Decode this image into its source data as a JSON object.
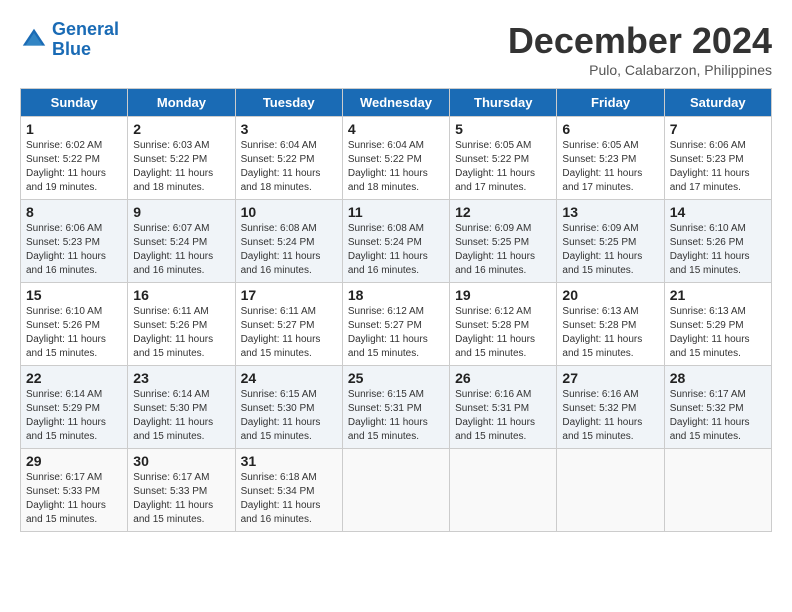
{
  "header": {
    "logo_line1": "General",
    "logo_line2": "Blue",
    "month": "December 2024",
    "location": "Pulo, Calabarzon, Philippines"
  },
  "days_of_week": [
    "Sunday",
    "Monday",
    "Tuesday",
    "Wednesday",
    "Thursday",
    "Friday",
    "Saturday"
  ],
  "weeks": [
    [
      {
        "day": "1",
        "info": "Sunrise: 6:02 AM\nSunset: 5:22 PM\nDaylight: 11 hours\nand 19 minutes."
      },
      {
        "day": "2",
        "info": "Sunrise: 6:03 AM\nSunset: 5:22 PM\nDaylight: 11 hours\nand 18 minutes."
      },
      {
        "day": "3",
        "info": "Sunrise: 6:04 AM\nSunset: 5:22 PM\nDaylight: 11 hours\nand 18 minutes."
      },
      {
        "day": "4",
        "info": "Sunrise: 6:04 AM\nSunset: 5:22 PM\nDaylight: 11 hours\nand 18 minutes."
      },
      {
        "day": "5",
        "info": "Sunrise: 6:05 AM\nSunset: 5:22 PM\nDaylight: 11 hours\nand 17 minutes."
      },
      {
        "day": "6",
        "info": "Sunrise: 6:05 AM\nSunset: 5:23 PM\nDaylight: 11 hours\nand 17 minutes."
      },
      {
        "day": "7",
        "info": "Sunrise: 6:06 AM\nSunset: 5:23 PM\nDaylight: 11 hours\nand 17 minutes."
      }
    ],
    [
      {
        "day": "8",
        "info": "Sunrise: 6:06 AM\nSunset: 5:23 PM\nDaylight: 11 hours\nand 16 minutes."
      },
      {
        "day": "9",
        "info": "Sunrise: 6:07 AM\nSunset: 5:24 PM\nDaylight: 11 hours\nand 16 minutes."
      },
      {
        "day": "10",
        "info": "Sunrise: 6:08 AM\nSunset: 5:24 PM\nDaylight: 11 hours\nand 16 minutes."
      },
      {
        "day": "11",
        "info": "Sunrise: 6:08 AM\nSunset: 5:24 PM\nDaylight: 11 hours\nand 16 minutes."
      },
      {
        "day": "12",
        "info": "Sunrise: 6:09 AM\nSunset: 5:25 PM\nDaylight: 11 hours\nand 16 minutes."
      },
      {
        "day": "13",
        "info": "Sunrise: 6:09 AM\nSunset: 5:25 PM\nDaylight: 11 hours\nand 15 minutes."
      },
      {
        "day": "14",
        "info": "Sunrise: 6:10 AM\nSunset: 5:26 PM\nDaylight: 11 hours\nand 15 minutes."
      }
    ],
    [
      {
        "day": "15",
        "info": "Sunrise: 6:10 AM\nSunset: 5:26 PM\nDaylight: 11 hours\nand 15 minutes."
      },
      {
        "day": "16",
        "info": "Sunrise: 6:11 AM\nSunset: 5:26 PM\nDaylight: 11 hours\nand 15 minutes."
      },
      {
        "day": "17",
        "info": "Sunrise: 6:11 AM\nSunset: 5:27 PM\nDaylight: 11 hours\nand 15 minutes."
      },
      {
        "day": "18",
        "info": "Sunrise: 6:12 AM\nSunset: 5:27 PM\nDaylight: 11 hours\nand 15 minutes."
      },
      {
        "day": "19",
        "info": "Sunrise: 6:12 AM\nSunset: 5:28 PM\nDaylight: 11 hours\nand 15 minutes."
      },
      {
        "day": "20",
        "info": "Sunrise: 6:13 AM\nSunset: 5:28 PM\nDaylight: 11 hours\nand 15 minutes."
      },
      {
        "day": "21",
        "info": "Sunrise: 6:13 AM\nSunset: 5:29 PM\nDaylight: 11 hours\nand 15 minutes."
      }
    ],
    [
      {
        "day": "22",
        "info": "Sunrise: 6:14 AM\nSunset: 5:29 PM\nDaylight: 11 hours\nand 15 minutes."
      },
      {
        "day": "23",
        "info": "Sunrise: 6:14 AM\nSunset: 5:30 PM\nDaylight: 11 hours\nand 15 minutes."
      },
      {
        "day": "24",
        "info": "Sunrise: 6:15 AM\nSunset: 5:30 PM\nDaylight: 11 hours\nand 15 minutes."
      },
      {
        "day": "25",
        "info": "Sunrise: 6:15 AM\nSunset: 5:31 PM\nDaylight: 11 hours\nand 15 minutes."
      },
      {
        "day": "26",
        "info": "Sunrise: 6:16 AM\nSunset: 5:31 PM\nDaylight: 11 hours\nand 15 minutes."
      },
      {
        "day": "27",
        "info": "Sunrise: 6:16 AM\nSunset: 5:32 PM\nDaylight: 11 hours\nand 15 minutes."
      },
      {
        "day": "28",
        "info": "Sunrise: 6:17 AM\nSunset: 5:32 PM\nDaylight: 11 hours\nand 15 minutes."
      }
    ],
    [
      {
        "day": "29",
        "info": "Sunrise: 6:17 AM\nSunset: 5:33 PM\nDaylight: 11 hours\nand 15 minutes."
      },
      {
        "day": "30",
        "info": "Sunrise: 6:17 AM\nSunset: 5:33 PM\nDaylight: 11 hours\nand 15 minutes."
      },
      {
        "day": "31",
        "info": "Sunrise: 6:18 AM\nSunset: 5:34 PM\nDaylight: 11 hours\nand 16 minutes."
      },
      {
        "day": "",
        "info": ""
      },
      {
        "day": "",
        "info": ""
      },
      {
        "day": "",
        "info": ""
      },
      {
        "day": "",
        "info": ""
      }
    ]
  ]
}
